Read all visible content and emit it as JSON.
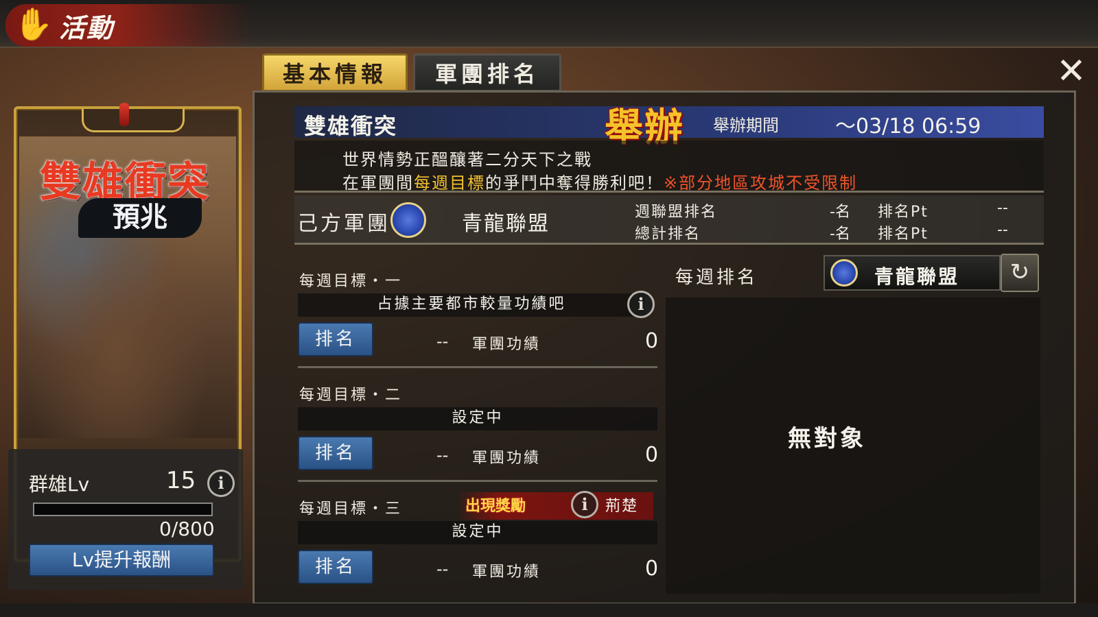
{
  "header": {
    "title": "活動"
  },
  "tabs": [
    {
      "label": "基本情報"
    },
    {
      "label": "軍團排名"
    }
  ],
  "card": {
    "title": "雙雄衝突",
    "subtitle": "預兆",
    "level_label": "群雄Lv",
    "level_value": "15",
    "progress_text": "0/800",
    "progress_fraction": 0,
    "reward_button": "Lv提升報酬"
  },
  "event": {
    "name": "雙雄衝突",
    "status": "舉辦",
    "period_label": "舉辦期間",
    "period_value": "～03/18 06:59",
    "desc_line1": "世界情勢正醞釀著二分天下之戰",
    "desc_line2_a": "在軍團間",
    "desc_line2_highlight": "每週目標",
    "desc_line2_b": "的爭鬥中奪得勝利吧！",
    "desc_line2_note": "※部分地區攻城不受限制"
  },
  "guild": {
    "label": "己方軍團",
    "name": "青龍聯盟",
    "weekly_rank_label": "週聯盟排名",
    "weekly_rank_value": "-名",
    "weekly_pt_label": "排名Pt",
    "weekly_pt_value": "--",
    "total_rank_label": "總計排名",
    "total_rank_value": "-名",
    "total_pt_label": "排名Pt",
    "total_pt_value": "--"
  },
  "goals": [
    {
      "title": "每週目標・一",
      "desc": "占據主要都市較量功績吧",
      "rank_button": "排名",
      "rank": "--",
      "merit_label": "軍團功績",
      "merit": "0"
    },
    {
      "title": "每週目標・二",
      "desc": "設定中",
      "rank_button": "排名",
      "rank": "--",
      "merit_label": "軍團功績",
      "merit": "0"
    },
    {
      "title": "每週目標・三",
      "desc": "設定中",
      "rank_button": "排名",
      "rank": "--",
      "merit_label": "軍團功績",
      "merit": "0",
      "reward_badge": "出現獎勵",
      "region": "荊楚"
    }
  ],
  "weekly_ranking": {
    "label": "每週排名",
    "selected_guild": "青龍聯盟",
    "empty_text": "無對象"
  },
  "colors": {
    "accent_gold": "#d2a43a",
    "button_blue": "#2a5286",
    "highlight_red": "#f0542a",
    "highlight_yellow": "#f2c030"
  }
}
